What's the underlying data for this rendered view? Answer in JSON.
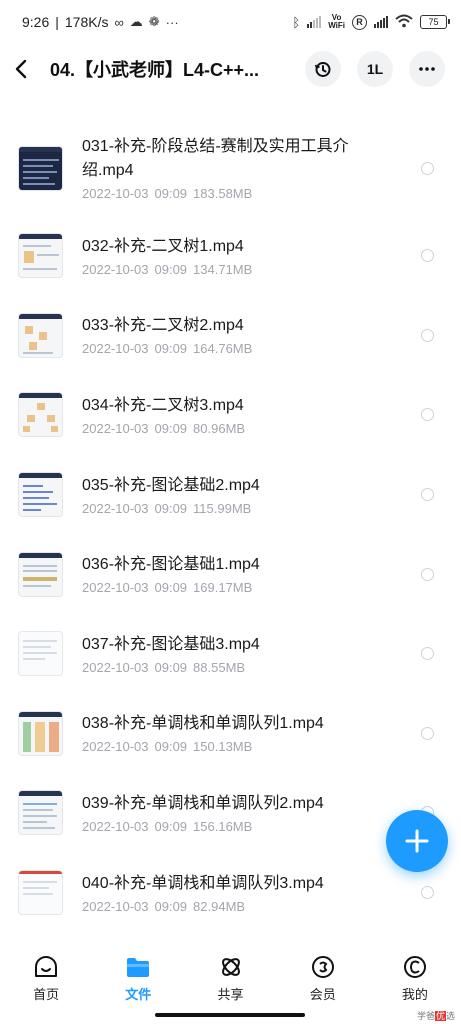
{
  "status_bar": {
    "time": "9:26",
    "speed": "178K/s",
    "left_icons": [
      "infinity-icon",
      "cloud-icon",
      "wechat-icon",
      "more-dots-icon"
    ],
    "right_icons": [
      "bluetooth-icon",
      "signal-icon",
      "vowifi-icon",
      "r-circle-icon",
      "signal-icon",
      "wifi-icon"
    ],
    "vowifi_top": "Vo",
    "vowifi_bottom": "WiFi",
    "r_label": "R",
    "battery": "75"
  },
  "header": {
    "title": "04.【小武老师】L4-C++...",
    "actions": [
      "history-icon",
      "sort-icon",
      "more-icon"
    ],
    "sort_label": "1L"
  },
  "files": [
    {
      "name": "031-补充-阶段总结-赛制及实用工具介绍.mp4",
      "date": "2022-10-03",
      "time": "09:09",
      "size": "183.58MB",
      "thumb": "dark"
    },
    {
      "name": "032-补充-二叉树1.mp4",
      "date": "2022-10-03",
      "time": "09:09",
      "size": "134.71MB",
      "thumb": "light"
    },
    {
      "name": "033-补充-二叉树2.mp4",
      "date": "2022-10-03",
      "time": "09:09",
      "size": "164.76MB",
      "thumb": "light"
    },
    {
      "name": "034-补充-二叉树3.mp4",
      "date": "2022-10-03",
      "time": "09:09",
      "size": "80.96MB",
      "thumb": "light"
    },
    {
      "name": "035-补充-图论基础2.mp4",
      "date": "2022-10-03",
      "time": "09:09",
      "size": "115.99MB",
      "thumb": "light"
    },
    {
      "name": "036-补充-图论基础1.mp4",
      "date": "2022-10-03",
      "time": "09:09",
      "size": "169.17MB",
      "thumb": "light"
    },
    {
      "name": "037-补充-图论基础3.mp4",
      "date": "2022-10-03",
      "time": "09:09",
      "size": "88.55MB",
      "thumb": "light"
    },
    {
      "name": "038-补充-单调栈和单调队列1.mp4",
      "date": "2022-10-03",
      "time": "09:09",
      "size": "150.13MB",
      "thumb": "light"
    },
    {
      "name": "039-补充-单调栈和单调队列2.mp4",
      "date": "2022-10-03",
      "time": "09:09",
      "size": "156.16MB",
      "thumb": "light"
    },
    {
      "name": "040-补充-单调栈和单调队列3.mp4",
      "date": "2022-10-03",
      "time": "09:09",
      "size": "82.94MB",
      "thumb": "light"
    }
  ],
  "fab": {
    "icon": "plus-icon"
  },
  "bottom_nav": [
    {
      "label": "首页",
      "icon": "home-icon",
      "active": false
    },
    {
      "label": "文件",
      "icon": "folder-icon",
      "active": true
    },
    {
      "label": "共享",
      "icon": "share-icon",
      "active": false
    },
    {
      "label": "会员",
      "icon": "vip-icon",
      "active": false
    },
    {
      "label": "我的",
      "icon": "profile-icon",
      "active": false
    }
  ],
  "watermark": {
    "text_a": "学爸",
    "text_b": "优",
    "text_c": "选",
    "small_a": "学爸",
    "small_b": "优",
    "small_c": "选"
  },
  "colors": {
    "accent": "#1e9bff",
    "meta": "#a2a6ad"
  }
}
